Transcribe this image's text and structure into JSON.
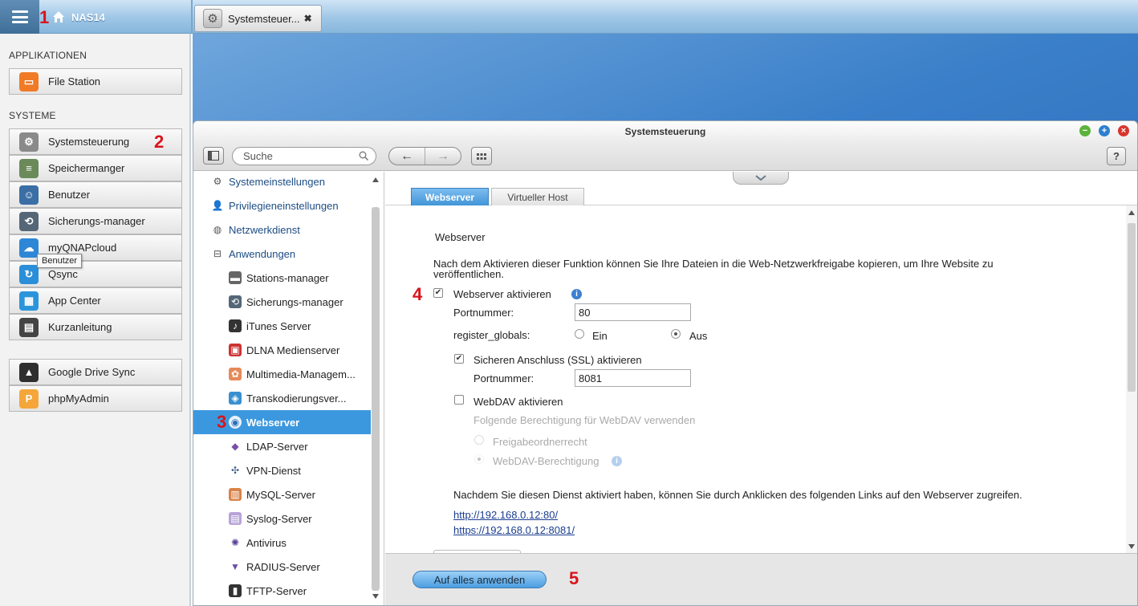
{
  "topbar": {
    "host_name": "NAS14",
    "task_tab_label": "Systemsteuer...",
    "task_tab_close": "✖"
  },
  "annotations": [
    "1",
    "2",
    "3",
    "4",
    "5"
  ],
  "sidebar": {
    "section_apps": "APPLIKATIONEN",
    "section_system": "SYSTEME",
    "apps": [
      {
        "label": "File Station",
        "icon": "folder-icon",
        "color": "#f07a26"
      }
    ],
    "system": [
      {
        "label": "Systemsteuerung",
        "icon": "gear-icon",
        "color": "#8a8a8a"
      },
      {
        "label": "Speichermanger",
        "icon": "storage-icon",
        "color": "#6a8a5a"
      },
      {
        "label": "Benutzer",
        "icon": "user-icon",
        "color": "#3a6ea5"
      },
      {
        "label": "Sicherungs-manager",
        "icon": "backup-icon",
        "color": "#556677"
      },
      {
        "label": "myQNAPcloud",
        "icon": "cloud-icon",
        "color": "#2d86d6"
      },
      {
        "label": "Qsync",
        "icon": "sync-icon",
        "color": "#2a8fd8"
      },
      {
        "label": "App Center",
        "icon": "grid-icon",
        "color": "#2b95db"
      },
      {
        "label": "Kurzanleitung",
        "icon": "guide-icon",
        "color": "#444444"
      }
    ],
    "extra": [
      {
        "label": "Google Drive Sync",
        "icon": "google-drive-icon",
        "color": "#2f2f2f"
      },
      {
        "label": "phpMyAdmin",
        "icon": "phpmyadmin-icon",
        "color": "#f4a63a"
      }
    ],
    "tooltip": "Benutzer"
  },
  "window": {
    "title": "Systemsteuerung",
    "search_placeholder": "Suche",
    "help": "?",
    "nav_back": "←",
    "nav_forward": "→"
  },
  "tree": {
    "top_items": [
      {
        "label": "Systemeinstellungen",
        "icon": "gear-icon"
      },
      {
        "label": "Privilegieneinstellungen",
        "icon": "user-icon"
      },
      {
        "label": "Netzwerkdienst",
        "icon": "globe-icon"
      },
      {
        "label": "Anwendungen",
        "icon": "tray-icon"
      }
    ],
    "sub_items": [
      {
        "label": "Stations-manager",
        "icon": "station-icon"
      },
      {
        "label": "Sicherungs-manager",
        "icon": "backup-icon"
      },
      {
        "label": "iTunes Server",
        "icon": "itunes-icon"
      },
      {
        "label": "DLNA Medienserver",
        "icon": "dlna-icon"
      },
      {
        "label": "Multimedia-Managem...",
        "icon": "multimedia-icon"
      },
      {
        "label": "Transkodierungsver...",
        "icon": "transcode-icon"
      },
      {
        "label": "Webserver",
        "icon": "webserver-icon",
        "selected": true
      },
      {
        "label": "LDAP-Server",
        "icon": "ldap-icon"
      },
      {
        "label": "VPN-Dienst",
        "icon": "vpn-icon"
      },
      {
        "label": "MySQL-Server",
        "icon": "database-icon"
      },
      {
        "label": "Syslog-Server",
        "icon": "syslog-icon"
      },
      {
        "label": "Antivirus",
        "icon": "antivirus-icon"
      },
      {
        "label": "RADIUS-Server",
        "icon": "radius-icon"
      },
      {
        "label": "TFTP-Server",
        "icon": "tftp-icon"
      }
    ]
  },
  "content": {
    "tabs": [
      "Webserver",
      "Virtueller Host"
    ],
    "heading": "Webserver",
    "description_line1": "Nach dem Aktivieren dieser Funktion können Sie Ihre Dateien in die Web-Netzwerkfreigabe kopieren, um Ihre Website zu",
    "description_line2": "veröffentlichen.",
    "webserver_enable_label": "Webserver aktivieren",
    "webserver_enabled": true,
    "port_label": "Portnummer:",
    "port_value": "80",
    "register_globals_label": "register_globals:",
    "radio_on_label": "Ein",
    "radio_off_label": "Aus",
    "register_globals_value": "Aus",
    "ssl_label": "Sicheren Anschluss (SSL) aktivieren",
    "ssl_enabled": true,
    "ssl_port_label": "Portnummer:",
    "ssl_port_value": "8081",
    "webdav_label": "WebDAV aktivieren",
    "webdav_enabled": false,
    "webdav_perm_label": "Folgende Berechtigung für WebDAV verwenden",
    "webdav_opt1": "Freigabeordnerrecht",
    "webdav_opt2": "WebDAV-Berechtigung",
    "link_intro": "Nachdem Sie diesen Dienst aktiviert haben, können Sie durch Anklicken des folgenden Links auf den Webserver zugreifen.",
    "link_http": "http://192.168.0.12:80/",
    "link_https": "https://192.168.0.12:8081/",
    "apply_button": "Auf alles anwenden"
  }
}
